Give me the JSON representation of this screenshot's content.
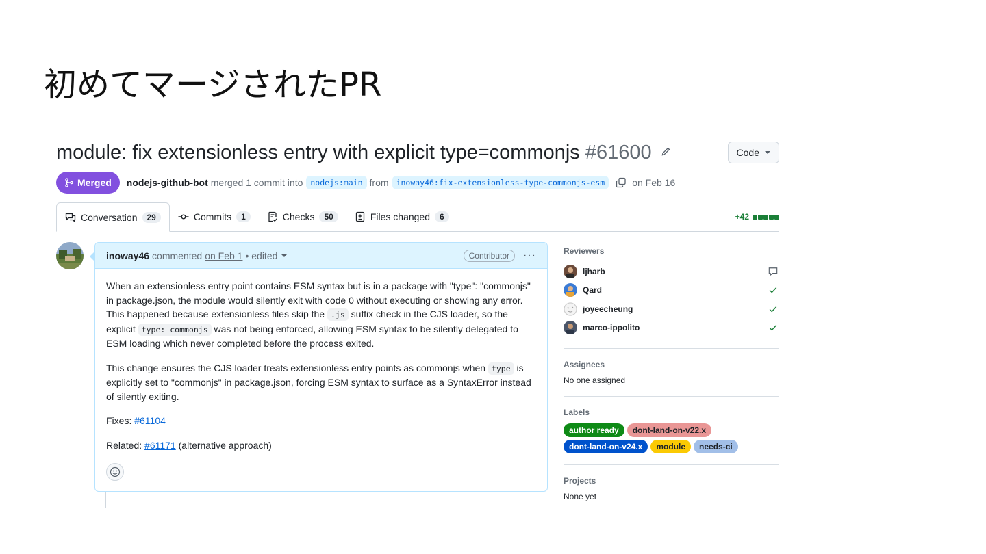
{
  "slide": {
    "title": "初めてマージされたPR"
  },
  "pr": {
    "title": "module: fix extensionless entry with explicit type=commonjs",
    "number": "#61600",
    "code_button": "Code",
    "status": "Merged",
    "merged_by": "nodejs-github-bot",
    "merge_text": "merged 1 commit into",
    "base_branch": "nodejs:main",
    "from_text": "from",
    "head_branch": "inoway46:fix-extensionless-type-commonjs-esm",
    "date": "on Feb 16",
    "colors": {
      "merged": "#8250df",
      "link": "#0969da",
      "added": "#1a7f37"
    }
  },
  "tabs": [
    {
      "label": "Conversation",
      "count": "29",
      "icon": "comment-discussion-icon"
    },
    {
      "label": "Commits",
      "count": "1",
      "icon": "git-commit-icon"
    },
    {
      "label": "Checks",
      "count": "50",
      "icon": "checklist-icon"
    },
    {
      "label": "Files changed",
      "count": "6",
      "icon": "file-diff-icon"
    }
  ],
  "diffstat": {
    "added": "+42"
  },
  "comment": {
    "author": "inoway46",
    "action": "commented",
    "date": "on Feb 1",
    "edited": "• edited",
    "role": "Contributor",
    "p1_a": "When an extensionless entry point contains ESM syntax but is in a package with \"type\": \"commonjs\" in package.json, the module would silently exit with code 0 without executing or showing any error. This happened because extensionless files skip the",
    "p1_code1": ".js",
    "p1_b": "suffix check in the CJS loader, so the explicit",
    "p1_code2": "type: commonjs",
    "p1_c": "was not being enforced, allowing ESM syntax to be silently delegated to ESM loading which never completed before the process exited.",
    "p2_a": "This change ensures the CJS loader treats extensionless entry points as commonjs when",
    "p2_code": "type",
    "p2_b": "is explicitly set to \"commonjs\" in package.json, forcing ESM syntax to surface as a SyntaxError instead of silently exiting.",
    "fixes_label": "Fixes:",
    "fixes_link": "#61104",
    "related_label": "Related:",
    "related_link": "#61171",
    "related_note": "(alternative approach)"
  },
  "sidebar": {
    "reviewers_title": "Reviewers",
    "reviewers": [
      {
        "name": "ljharb",
        "status": "commented"
      },
      {
        "name": "Qard",
        "status": "approved"
      },
      {
        "name": "joyeecheung",
        "status": "approved"
      },
      {
        "name": "marco-ippolito",
        "status": "approved"
      }
    ],
    "assignees_title": "Assignees",
    "assignees_value": "No one assigned",
    "labels_title": "Labels",
    "labels": [
      {
        "name": "author ready",
        "bg": "#0e8a16",
        "fg": "#ffffff"
      },
      {
        "name": "dont-land-on-v22.x",
        "bg": "#e99695",
        "fg": "#1f2328"
      },
      {
        "name": "dont-land-on-v24.x",
        "bg": "#0052cc",
        "fg": "#ffffff"
      },
      {
        "name": "module",
        "bg": "#fbca04",
        "fg": "#1f2328"
      },
      {
        "name": "needs-ci",
        "bg": "#a2bfe8",
        "fg": "#1f2328"
      }
    ],
    "projects_title": "Projects",
    "projects_value": "None yet"
  }
}
